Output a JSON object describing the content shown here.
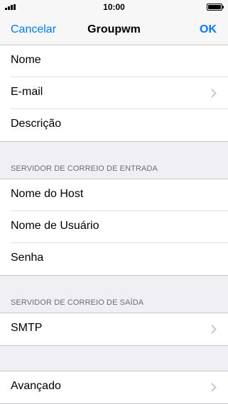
{
  "status_bar": {
    "time": "10:00"
  },
  "nav": {
    "cancel_label": "Cancelar",
    "title": "Groupwm",
    "ok_label": "OK"
  },
  "account_section": {
    "rows": [
      {
        "label": "Nome",
        "chevron": false
      },
      {
        "label": "E-mail",
        "chevron": true
      },
      {
        "label": "Descrição",
        "chevron": false
      }
    ]
  },
  "incoming_section": {
    "header": "SERVIDOR DE CORREIO DE ENTRADA",
    "rows": [
      {
        "label": "Nome do Host"
      },
      {
        "label": "Nome de Usuário"
      },
      {
        "label": "Senha"
      }
    ]
  },
  "outgoing_section": {
    "header": "SERVIDOR DE CORREIO DE SAÍDA",
    "rows": [
      {
        "label": "SMTP",
        "chevron": true
      }
    ]
  },
  "advanced_section": {
    "rows": [
      {
        "label": "Avançado",
        "chevron": true
      }
    ]
  },
  "colors": {
    "accent": "#007aff",
    "background": "#efeff4",
    "chevron": "#c7c7cc"
  }
}
